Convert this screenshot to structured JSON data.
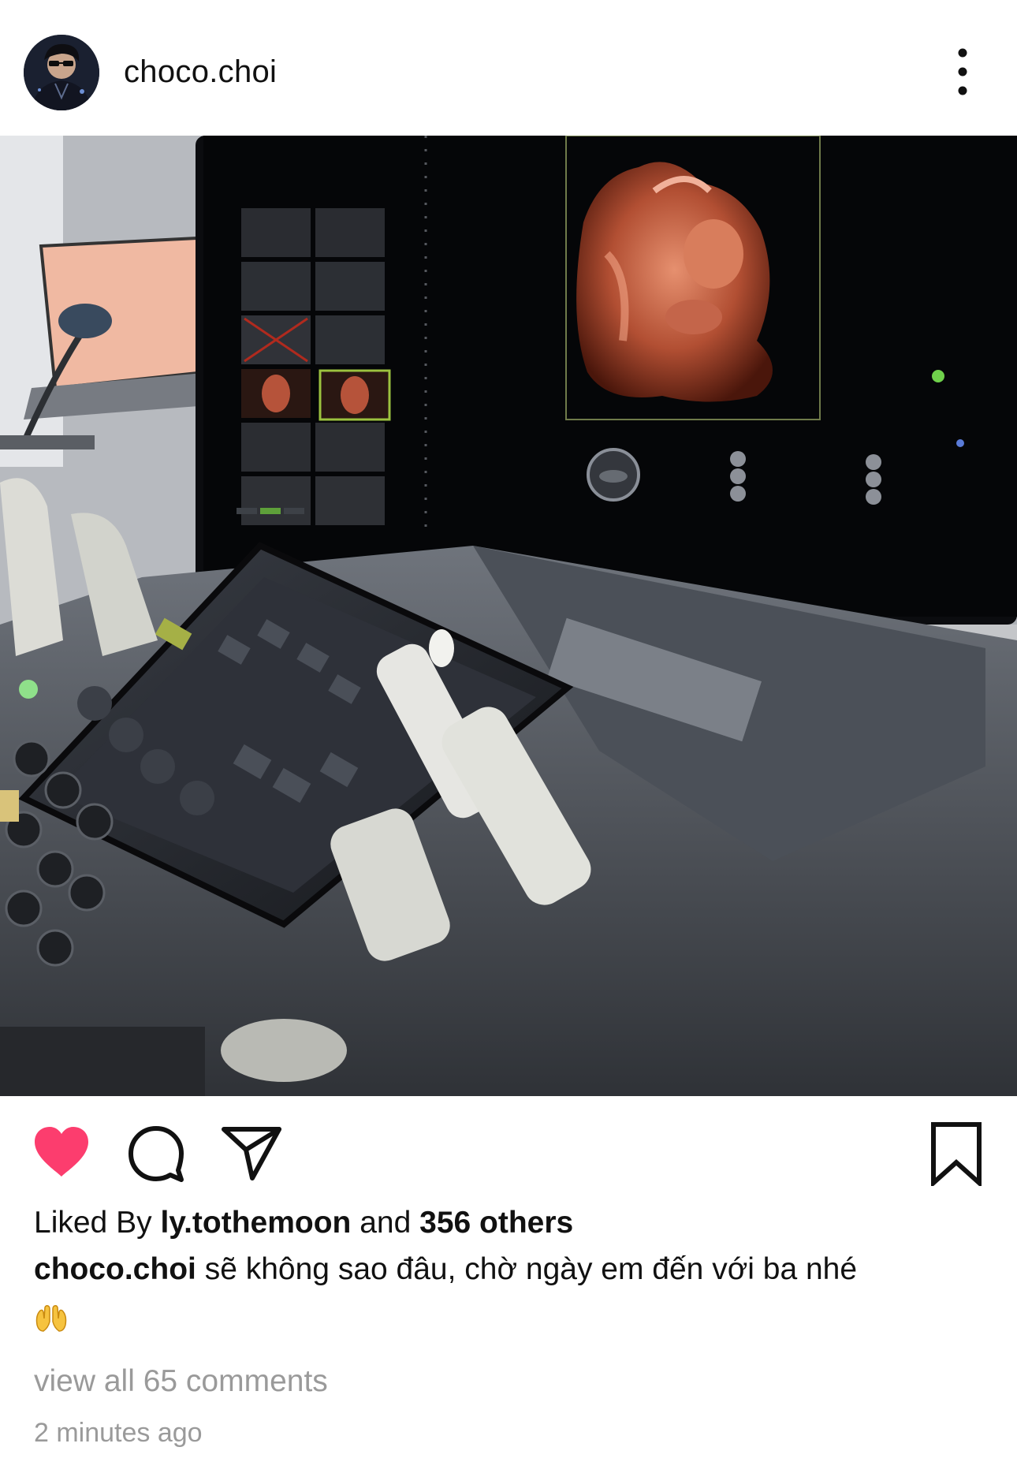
{
  "post": {
    "username": "choco.choi",
    "likes": {
      "prefix": "Liked By",
      "liker": "ly.tothemoon",
      "connector": "and",
      "others": "356 others"
    },
    "caption": {
      "username": "choco.choi",
      "text": "sẽ không sao đâu, chờ ngày em đến với ba nhé",
      "emoji": "hands-emoji"
    },
    "view_comments": "view all 65 comments",
    "timestamp": "2 minutes ago",
    "liked": true
  },
  "icons": {
    "more": "more-vertical-icon",
    "like": "heart-icon",
    "comment": "comment-icon",
    "share": "send-icon",
    "save": "bookmark-icon"
  },
  "colors": {
    "like_active": "#fc3d6e",
    "text_primary": "#111111",
    "text_secondary": "#9a9a9a",
    "background": "#ffffff"
  }
}
